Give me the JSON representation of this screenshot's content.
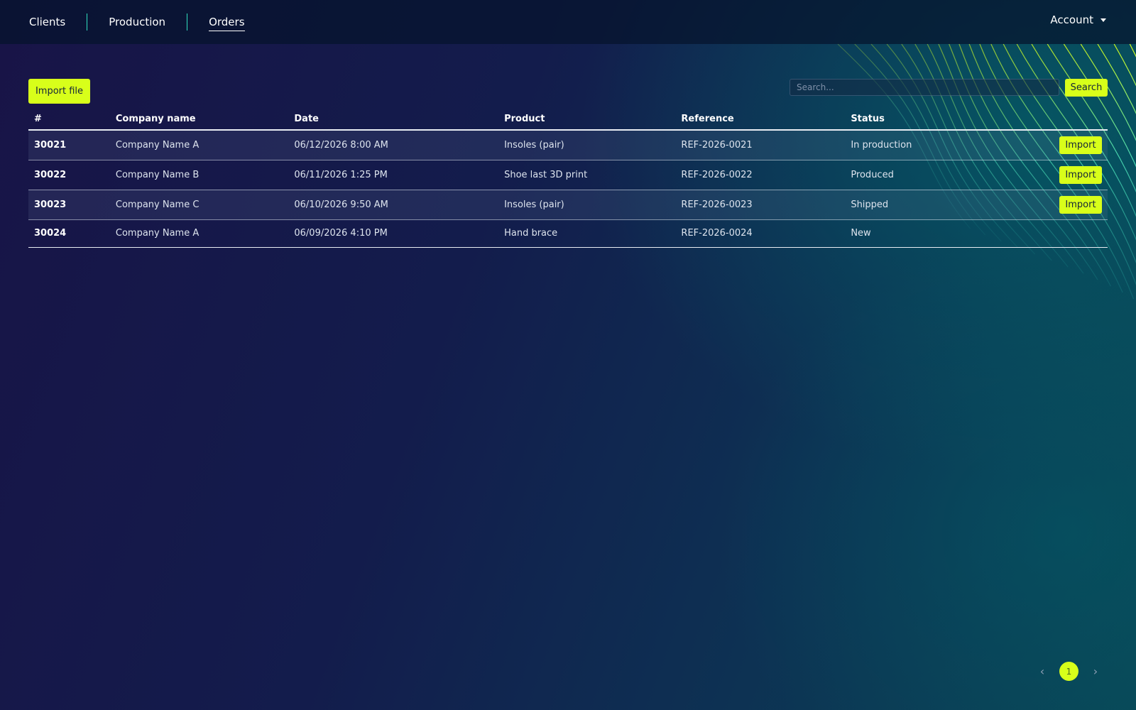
{
  "nav": {
    "items": [
      {
        "label": "Clients"
      },
      {
        "label": "Production"
      },
      {
        "label": "Orders",
        "active": true
      }
    ],
    "account_label": "Account"
  },
  "toolbar": {
    "import_file_label": "Import file",
    "search_placeholder": "Search...",
    "search_label": "Search"
  },
  "table": {
    "headers": [
      "#",
      "Company name",
      "Date",
      "Product",
      "Reference",
      "Status"
    ],
    "rows": [
      {
        "id": "30021",
        "company": "Company Name A",
        "date": "06/12/2026 8:00 AM",
        "product": "Insoles (pair)",
        "reference": "REF-2026-0021",
        "status": "In production",
        "action": "Import"
      },
      {
        "id": "30022",
        "company": "Company Name B",
        "date": "06/11/2026 1:25 PM",
        "product": "Shoe last 3D print",
        "reference": "REF-2026-0022",
        "status": "Produced",
        "action": "Import"
      },
      {
        "id": "30023",
        "company": "Company Name C",
        "date": "06/10/2026 9:50 AM",
        "product": "Insoles (pair)",
        "reference": "REF-2026-0023",
        "status": "Shipped",
        "action": "Import"
      },
      {
        "id": "30024",
        "company": "Company Name A",
        "date": "06/09/2026 4:10 PM",
        "product": "Hand brace",
        "reference": "REF-2026-0024",
        "status": "New",
        "action": ""
      }
    ]
  },
  "pagination": {
    "prev_icon": "chevron-left-icon",
    "current_page": "1",
    "next_icon": "chevron-right-icon"
  },
  "colors": {
    "accent": "#d8ff1a",
    "nav_separator": "#2fe0c0",
    "background_start": "#181447",
    "background_end": "#0a4656"
  }
}
